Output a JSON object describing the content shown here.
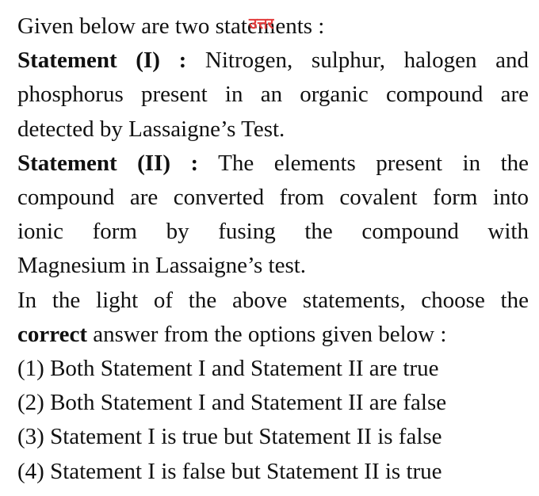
{
  "intro": "Given below are two statements :",
  "watermark_text": "उत्तर",
  "statement1": {
    "label": "Statement (I)",
    "sep": ":",
    "line1": "Nitrogen, sulphur, halogen and",
    "line2": "phosphorus present in an organic compound are",
    "line3": "detected by Lassaigne’s Test."
  },
  "statement2": {
    "label": "Statement (II)",
    "sep": ":",
    "line1": "The elements present in the",
    "line2": "compound are converted from covalent form into",
    "line3": "ionic form by fusing the compound with",
    "line4": "Magnesium in Lassaigne’s test."
  },
  "question": {
    "line1": "In the light of the above statements, choose the",
    "bold_word": "correct",
    "line2_rest": " answer from the options given below :"
  },
  "options": [
    "(1) Both Statement I and Statement II are true",
    "(2) Both Statement I and Statement II are false",
    "(3) Statement I is true but Statement II is false",
    "(4) Statement I is false but Statement II is true"
  ]
}
